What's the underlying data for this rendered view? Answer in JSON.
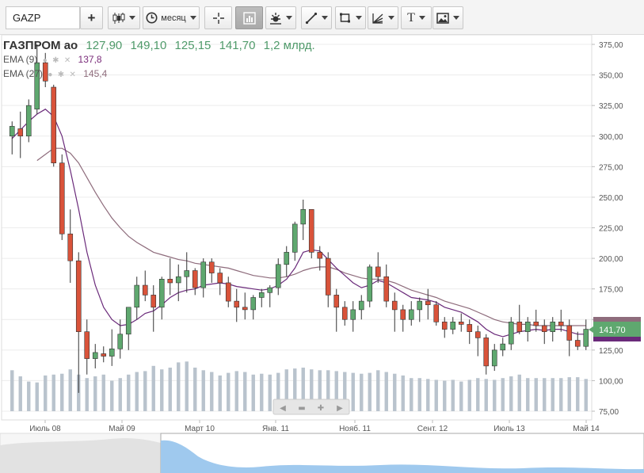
{
  "toolbar": {
    "ticker_value": "GAZP",
    "add_label": "+",
    "period_label": "месяц"
  },
  "legend": {
    "symbol": "ГАЗПРОМ ао",
    "open": "127,90",
    "high": "149,10",
    "low": "125,15",
    "close": "141,70",
    "volume": "1,2 млрд.",
    "ema_fast_label": "EMA (9)",
    "ema_fast_value": "137,8",
    "ema_slow_label": "EMA (27)",
    "ema_slow_value": "145,4"
  },
  "price_badge": "141,70",
  "colors": {
    "up": "#5fa86f",
    "down": "#d9533a",
    "ema_fast": "#6a2a7a",
    "ema_slow": "#8e6c7c",
    "volume": "#b9c3cd",
    "navigator_fill": "#9fc9ee"
  },
  "chart_data": {
    "type": "candlestick",
    "y_ticks": [
      "375,00",
      "350,00",
      "325,00",
      "300,00",
      "275,00",
      "250,00",
      "225,00",
      "200,00",
      "175,00",
      "150,00",
      "125,00",
      "100,00",
      "75,00"
    ],
    "x_labels": [
      "Июль 08",
      "Май 09",
      "Март 10",
      "Янв. 11",
      "Нояб. 11",
      "Сент. 12",
      "Июль 13",
      "Май 14"
    ],
    "ylim": [
      70,
      385
    ],
    "candles": [
      [
        300,
        312,
        285,
        308
      ],
      [
        306,
        320,
        282,
        300
      ],
      [
        300,
        330,
        295,
        325
      ],
      [
        322,
        375,
        318,
        360
      ],
      [
        360,
        368,
        340,
        345
      ],
      [
        340,
        342,
        275,
        278
      ],
      [
        278,
        285,
        215,
        220
      ],
      [
        220,
        240,
        180,
        198
      ],
      [
        198,
        205,
        90,
        140
      ],
      [
        140,
        150,
        105,
        118
      ],
      [
        118,
        130,
        110,
        123
      ],
      [
        122,
        128,
        115,
        120
      ],
      [
        120,
        142,
        112,
        126
      ],
      [
        126,
        150,
        118,
        138
      ],
      [
        138,
        160,
        125,
        160
      ],
      [
        160,
        185,
        150,
        178
      ],
      [
        178,
        190,
        165,
        170
      ],
      [
        170,
        178,
        140,
        160
      ],
      [
        160,
        185,
        150,
        183
      ],
      [
        183,
        200,
        170,
        180
      ],
      [
        180,
        195,
        165,
        185
      ],
      [
        185,
        205,
        172,
        190
      ],
      [
        190,
        192,
        170,
        176
      ],
      [
        176,
        200,
        168,
        197
      ],
      [
        197,
        200,
        180,
        188
      ],
      [
        188,
        192,
        170,
        180
      ],
      [
        180,
        185,
        160,
        165
      ],
      [
        165,
        175,
        148,
        160
      ],
      [
        160,
        172,
        150,
        158
      ],
      [
        158,
        170,
        150,
        168
      ],
      [
        168,
        175,
        160,
        172
      ],
      [
        172,
        178,
        160,
        176
      ],
      [
        176,
        200,
        170,
        195
      ],
      [
        195,
        210,
        185,
        205
      ],
      [
        205,
        230,
        198,
        228
      ],
      [
        228,
        248,
        215,
        240
      ],
      [
        240,
        236,
        200,
        205
      ],
      [
        205,
        210,
        190,
        200
      ],
      [
        200,
        205,
        160,
        170
      ],
      [
        170,
        175,
        140,
        160
      ],
      [
        160,
        165,
        145,
        150
      ],
      [
        150,
        165,
        140,
        158
      ],
      [
        158,
        170,
        150,
        165
      ],
      [
        165,
        195,
        160,
        193
      ],
      [
        193,
        205,
        180,
        185
      ],
      [
        185,
        195,
        160,
        165
      ],
      [
        165,
        172,
        140,
        158
      ],
      [
        158,
        162,
        140,
        150
      ],
      [
        150,
        165,
        145,
        158
      ],
      [
        158,
        168,
        148,
        165
      ],
      [
        165,
        175,
        150,
        162
      ],
      [
        162,
        165,
        145,
        148
      ],
      [
        148,
        152,
        135,
        142
      ],
      [
        142,
        152,
        138,
        148
      ],
      [
        148,
        155,
        140,
        146
      ],
      [
        146,
        150,
        130,
        140
      ],
      [
        140,
        145,
        120,
        135
      ],
      [
        135,
        138,
        105,
        112
      ],
      [
        112,
        130,
        108,
        125
      ],
      [
        125,
        135,
        120,
        130
      ],
      [
        130,
        152,
        125,
        148
      ],
      [
        148,
        162,
        138,
        140
      ],
      [
        140,
        152,
        132,
        148
      ],
      [
        148,
        158,
        140,
        145
      ],
      [
        145,
        150,
        130,
        140
      ],
      [
        140,
        152,
        132,
        148
      ],
      [
        148,
        158,
        140,
        145
      ],
      [
        145,
        150,
        120,
        133
      ],
      [
        133,
        140,
        125,
        128
      ],
      [
        128,
        150,
        125,
        142
      ]
    ],
    "ema_fast": [
      298,
      305,
      312,
      318,
      322,
      316,
      300,
      272,
      240,
      205,
      178,
      160,
      150,
      145,
      146,
      150,
      155,
      157,
      162,
      168,
      172,
      174,
      175,
      178,
      179,
      180,
      179,
      177,
      176,
      175,
      174,
      175,
      178,
      183,
      192,
      205,
      207,
      206,
      199,
      192,
      186,
      180,
      176,
      178,
      182,
      180,
      176,
      172,
      168,
      167,
      166,
      164,
      160,
      158,
      156,
      152,
      148,
      142,
      138,
      136,
      138,
      140,
      141,
      142,
      141,
      142,
      142,
      140,
      138,
      138
    ],
    "ema_slow": [
      null,
      null,
      null,
      280,
      285,
      290,
      290,
      286,
      278,
      266,
      254,
      243,
      233,
      225,
      218,
      213,
      209,
      205,
      203,
      201,
      199,
      198,
      196,
      195,
      194,
      193,
      192,
      190,
      188,
      186,
      185,
      184,
      184,
      185,
      187,
      190,
      192,
      193,
      193,
      191,
      188,
      186,
      184,
      183,
      183,
      182,
      180,
      177,
      174,
      172,
      170,
      168,
      165,
      163,
      161,
      159,
      156,
      153,
      150,
      148,
      147,
      146,
      146,
      145,
      145,
      145,
      145,
      145,
      145,
      145
    ],
    "volume": [
      470,
      400,
      340,
      330,
      410,
      420,
      430,
      480,
      420,
      380,
      400,
      420,
      350,
      380,
      420,
      450,
      460,
      520,
      480,
      500,
      560,
      570,
      500,
      470,
      450,
      410,
      440,
      460,
      450,
      420,
      430,
      420,
      440,
      480,
      490,
      500,
      480,
      470,
      470,
      460,
      450,
      440,
      430,
      440,
      470,
      450,
      430,
      410,
      380,
      380,
      370,
      360,
      350,
      360,
      340,
      360,
      380,
      370,
      360,
      380,
      400,
      420,
      380,
      380,
      380,
      380,
      380,
      390,
      390,
      370
    ]
  },
  "navigator": {
    "scroll_left_label": "◀",
    "scroll_right_label": "▶"
  }
}
